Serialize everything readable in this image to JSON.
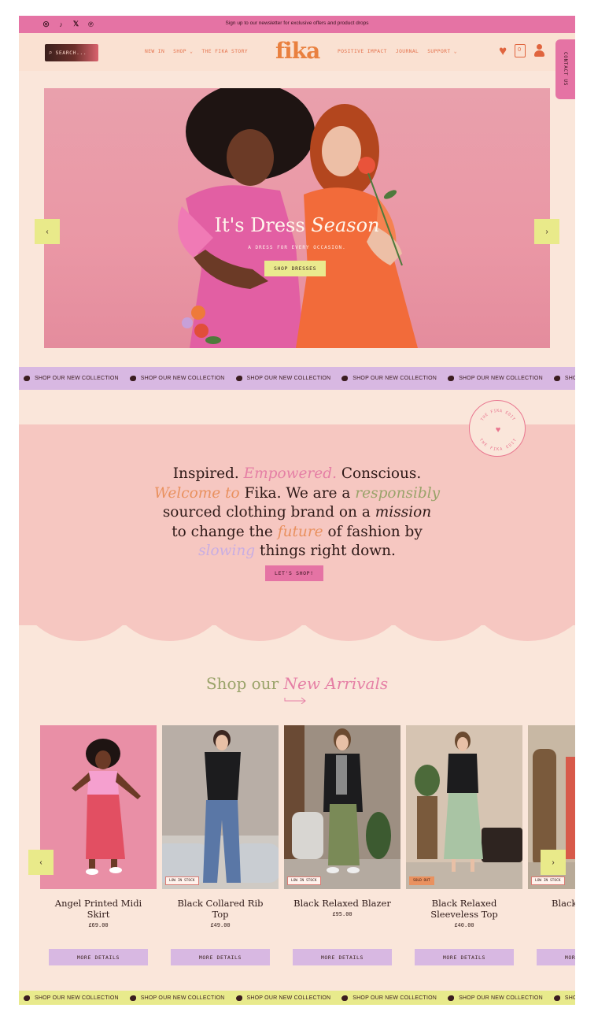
{
  "topbar": {
    "promo": "Sign up to our newsletter for exclusive offers and product drops",
    "social": [
      "instagram-icon",
      "tiktok-icon",
      "x-icon",
      "pinterest-icon"
    ]
  },
  "header": {
    "search_label": "SEARCH...",
    "logo": "fika",
    "nav_left": [
      "NEW IN",
      "SHOP ⌄",
      "THE FIKA STORY"
    ],
    "nav_right": [
      "POSITIVE IMPACT",
      "JOURNAL",
      "SUPPORT ⌄"
    ],
    "bag_count": "0",
    "contact_label": "CONTACT US"
  },
  "hero": {
    "title_plain": "It's Dress",
    "title_italic": "Season",
    "subtitle": "A DRESS FOR EVERY OCCASION.",
    "button": "SHOP DRESSES",
    "prev": "‹",
    "next": "›"
  },
  "marquee": {
    "text": "SHOP OUR NEW COLLECTION"
  },
  "mission": {
    "badge_text": "THE FIKA EDIT",
    "l1a": "Inspired. ",
    "l1b": "Empowered.",
    "l1c": " Conscious.",
    "l2a": "Welcome to",
    "l2b": " Fika. We are a ",
    "l2c": "responsibly",
    "l3a": "sourced clothing brand on a ",
    "l3b": "mission",
    "l4a": "to change the ",
    "l4b": "future",
    "l4c": " of fashion by",
    "l5a": "slowing",
    "l5b": " things right down.",
    "button": "LET'S SHOP!"
  },
  "new_arrivals": {
    "title_plain": "Shop our ",
    "title_italic": "New Arrivals",
    "more_label": "MORE DETAILS",
    "prev": "‹",
    "next": "›",
    "products": [
      {
        "name": "Angel Printed Midi Skirt",
        "price": "£69.00",
        "tag": ""
      },
      {
        "name": "Black Collared Rib Top",
        "price": "£49.00",
        "tag": "LOW IN STOCK"
      },
      {
        "name": "Black Relaxed Blazer",
        "price": "£95.00",
        "tag": "LOW IN STOCK"
      },
      {
        "name": "Black Relaxed Sleeveless Top",
        "price": "£40.00",
        "tag": "SOLD OUT"
      },
      {
        "name": "Black",
        "price": "",
        "tag": "LOW IN STOCK"
      }
    ]
  },
  "colors": {
    "pink": "#e573a4",
    "orange": "#e9803f",
    "lavender": "#d8b8e2",
    "yellow": "#e9ea8a",
    "cream": "#fae6da",
    "blush": "#f6c7c1"
  }
}
